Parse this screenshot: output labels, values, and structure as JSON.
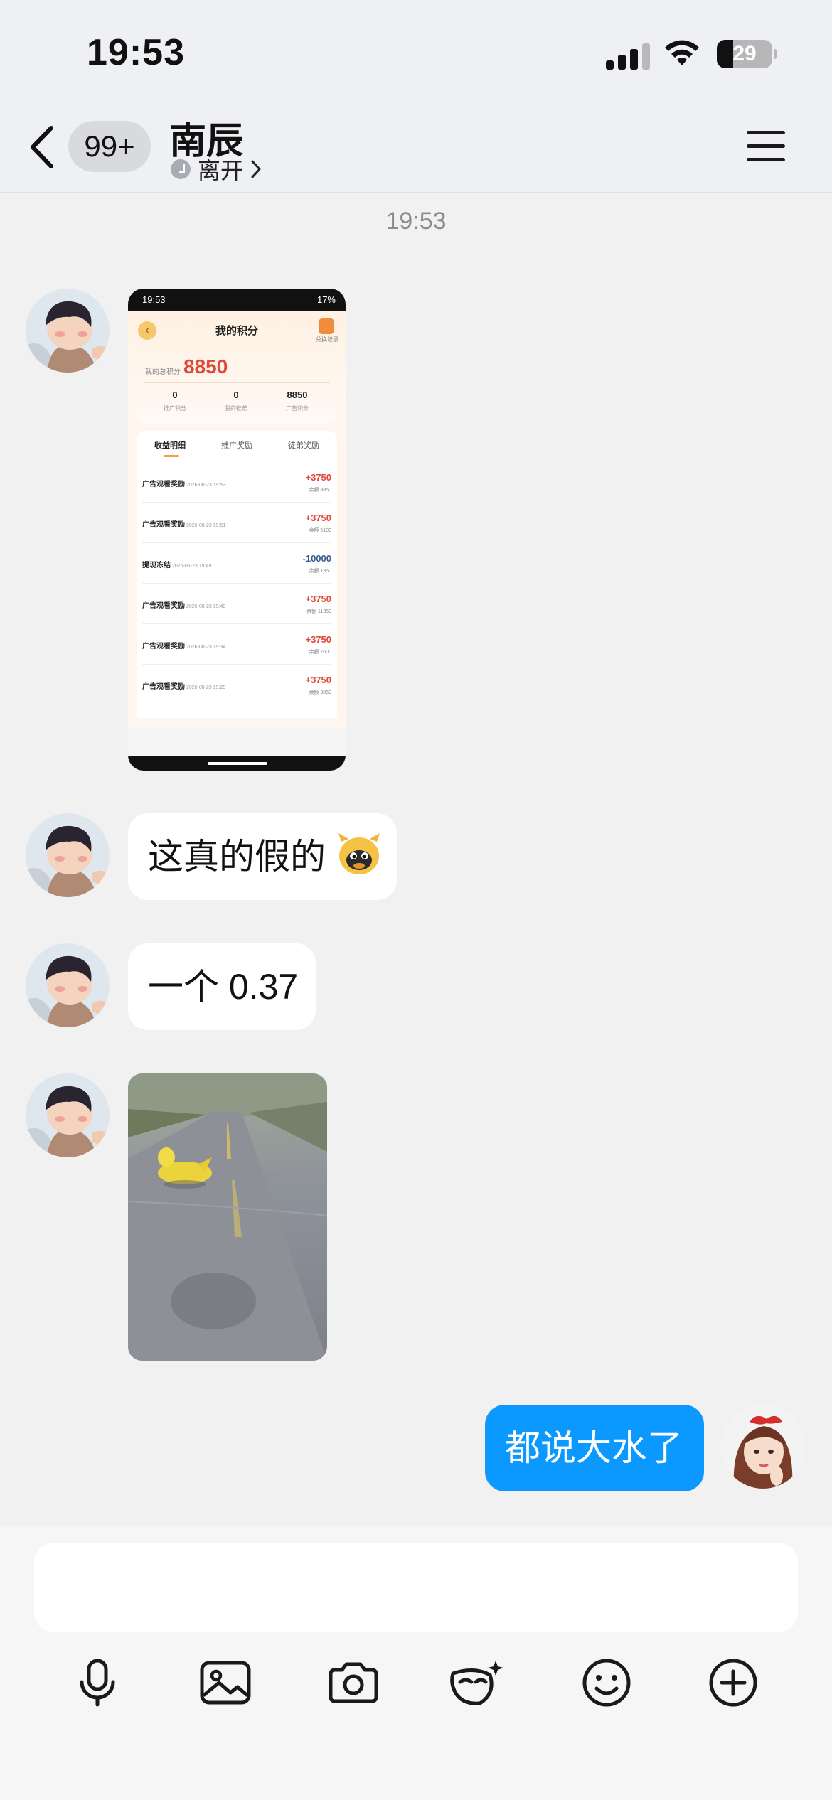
{
  "status_bar": {
    "time": "19:53",
    "battery": "29"
  },
  "header": {
    "unread_badge": "99+",
    "contact_name": "南辰",
    "contact_status": "离开"
  },
  "chat": {
    "timestamp": "19:53",
    "messages": [
      {
        "sender": "contact",
        "type": "image",
        "kind": "screenshot"
      },
      {
        "sender": "contact",
        "type": "text",
        "text": "这真的假的",
        "emoji": "🐮"
      },
      {
        "sender": "contact",
        "type": "text",
        "text": "一个 0.37"
      },
      {
        "sender": "contact",
        "type": "video"
      },
      {
        "sender": "me",
        "type": "text",
        "text": "都说大水了"
      }
    ]
  },
  "shared_screenshot": {
    "status_time": "19:53",
    "status_right": "17%",
    "title": "我的积分",
    "record_link": "兑换记录",
    "total_label": "我的总积分",
    "total_value": "8850",
    "stats": [
      {
        "value": "0",
        "label": "推广积分"
      },
      {
        "value": "0",
        "label": "我的徒弟"
      },
      {
        "value": "8850",
        "label": "广告积分"
      }
    ],
    "tabs": [
      "收益明细",
      "推广奖励",
      "徒弟奖励"
    ],
    "active_tab": "收益明细",
    "rows": [
      {
        "name": "广告观看奖励",
        "date": "2026-08-23 19:53",
        "amount": "+3750",
        "balance": "余额 8850"
      },
      {
        "name": "广告观看奖励",
        "date": "2026-08-23 19:51",
        "amount": "+3750",
        "balance": "余额 5100"
      },
      {
        "name": "提现冻结",
        "date": "2026-08-23 19:49",
        "amount": "-10000",
        "balance": "余额 1350"
      },
      {
        "name": "广告观看奖励",
        "date": "2026-08-23 19:49",
        "amount": "+3750",
        "balance": "余额 11350"
      },
      {
        "name": "广告观看奖励",
        "date": "2026-08-23 19:34",
        "amount": "+3750",
        "balance": "余额 7600"
      },
      {
        "name": "广告观看奖励",
        "date": "2026-08-23 19:29",
        "amount": "+3750",
        "balance": "余额 3850"
      }
    ]
  },
  "composer": {
    "input_value": "",
    "tools": [
      "microphone-icon",
      "image-icon",
      "camera-icon",
      "sticker-icon",
      "emoji-icon",
      "plus-icon"
    ]
  },
  "colors": {
    "my_bubble": "#0b99ff",
    "background": "#f1f1f1",
    "accent_red": "#e0483a"
  }
}
